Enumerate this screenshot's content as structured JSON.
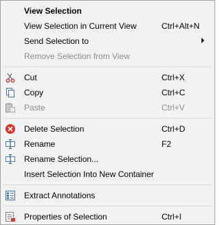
{
  "menu": {
    "view_selection": {
      "label": "View Selection"
    },
    "view_selection_current": {
      "label": "View Selection in Current View",
      "shortcut": "Ctrl+Alt+N"
    },
    "send_selection_to": {
      "label": "Send Selection to"
    },
    "remove_selection": {
      "label": "Remove Selection from View"
    },
    "cut": {
      "label": "Cut",
      "shortcut": "Ctrl+X",
      "icon": "scissors-icon"
    },
    "copy": {
      "label": "Copy",
      "shortcut": "Ctrl+C",
      "icon": "copy-icon"
    },
    "paste": {
      "label": "Paste",
      "shortcut": "Ctrl+V",
      "icon": "paste-icon"
    },
    "delete_selection": {
      "label": "Delete Selection",
      "shortcut": "Ctrl+D",
      "icon": "delete-icon"
    },
    "rename": {
      "label": "Rename",
      "shortcut": "F2",
      "icon": "rename-icon"
    },
    "rename_selection": {
      "label": "Rename Selection...",
      "icon": "rename-icon"
    },
    "insert_selection": {
      "label": "Insert Selection Into New Container"
    },
    "extract_annotations": {
      "label": "Extract Annotations",
      "icon": "annotations-icon"
    },
    "properties_of_selection": {
      "label": "Properties of Selection",
      "shortcut": "Ctrl+I",
      "icon": "properties-icon"
    }
  }
}
